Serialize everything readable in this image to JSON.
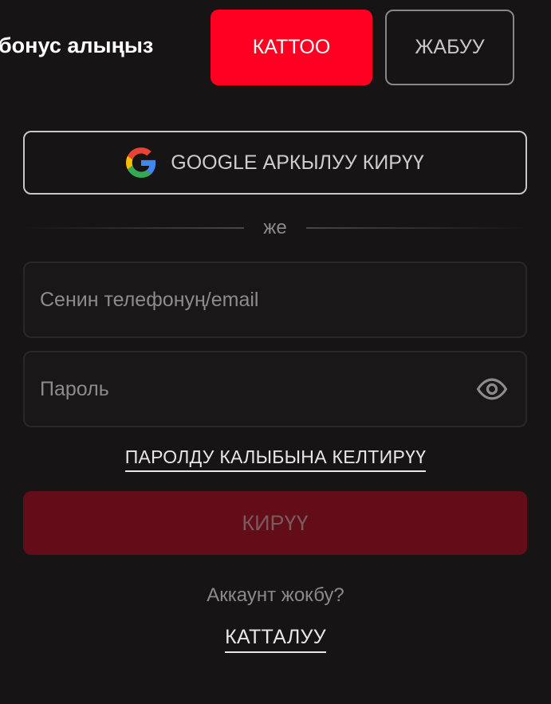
{
  "header": {
    "promo_text": "бонус алыңыз",
    "register_label": "КАТТОО",
    "close_label": "ЖАБУУ"
  },
  "google": {
    "label": "GOOGLE АРКЫЛУУ КИРҮҮ",
    "icon": "google-icon"
  },
  "divider": {
    "text": "же"
  },
  "form": {
    "phone_placeholder": "Сенин телефонуң/email",
    "phone_value": "",
    "password_placeholder": "Пароль",
    "password_value": "",
    "password_toggle_icon": "eye-icon",
    "reset_link": "ПАРОЛДУ КАЛЫБЫНА КЕЛТИРҮҮ",
    "submit_label": "КИРҮҮ"
  },
  "footer": {
    "question": "Аккаунт жокбу?",
    "signup_link": "КАТТАЛУУ"
  },
  "colors": {
    "background": "#171415",
    "accent": "#ff0022",
    "submit_disabled": "#620d18"
  }
}
